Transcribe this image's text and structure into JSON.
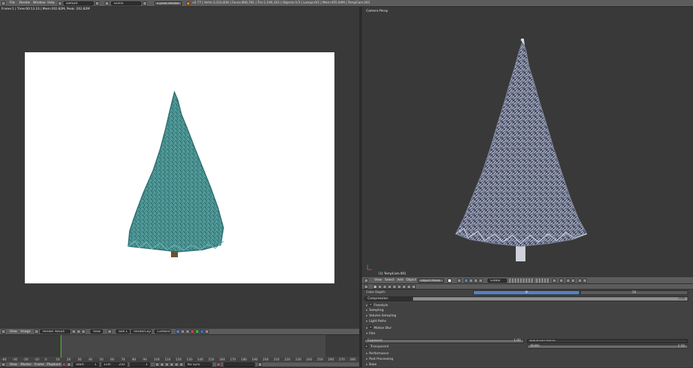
{
  "topbar": {
    "menus": [
      "File",
      "Render",
      "Window",
      "Help"
    ],
    "layout": "Default",
    "scene": "Scene",
    "engine": "Cycles Render",
    "stats": "v2.77 | Verts:3,210,836 | Faces:806,781 | Tris:1,546,103 | Objects:1/3 | Lamps:0/1 | Mem:455.04M | TempCam.001"
  },
  "render_view": {
    "info": "Frame:1 | Time:00:13.23 | Mem:202.82M, Peak: 202.82M",
    "header": {
      "view": "View",
      "image": "Image",
      "image_name": "Render Result",
      "view2": "View",
      "slot": "Slot 1",
      "layer": "RenderLayer",
      "pass": "Combined"
    }
  },
  "viewport": {
    "title": "Camera Persp",
    "object_label": "(1) TempCam.001",
    "header": {
      "view": "View",
      "select": "Select",
      "add": "Add",
      "object": "Object",
      "mode": "Object Mode",
      "orientation": "Global"
    }
  },
  "properties": {
    "color_depth_label": "Color Depth:",
    "color_depth_options": [
      "8",
      "16"
    ],
    "compression_label": "Compression:",
    "compression_value": "15%",
    "panels": [
      "Freestyle",
      "Sampling",
      "Volume Sampling",
      "Light Paths",
      "Motion Blur"
    ],
    "film": {
      "label": "Film",
      "exposure_label": "Exposure:",
      "exposure_value": "1.00",
      "filter": "Blackman-Harris",
      "transparent_label": "Transparent",
      "width_label": "Width:",
      "width_value": "1.50"
    },
    "panels_after": [
      "Performance",
      "Post Processing",
      "Bake"
    ]
  },
  "timeline": {
    "menus": [
      "View",
      "Marker",
      "Frame",
      "Playback"
    ],
    "start_label": "Start:",
    "start_value": "1",
    "end_label": "End:",
    "end_value": "250",
    "current": "1",
    "sync": "No Sync",
    "ruler": [
      "-40",
      "-30",
      "-20",
      "-10",
      "0",
      "10",
      "20",
      "30",
      "40",
      "50",
      "60",
      "70",
      "80",
      "90",
      "100",
      "110",
      "120",
      "130",
      "140",
      "150",
      "160",
      "170",
      "180",
      "190",
      "200",
      "210",
      "220",
      "230",
      "240",
      "250",
      "260",
      "270",
      "280"
    ]
  },
  "colors": {
    "accent_blue": "#5680c2",
    "header": "#5c5c5c",
    "background": "#393939",
    "tree_green": "#3f8a8a"
  }
}
